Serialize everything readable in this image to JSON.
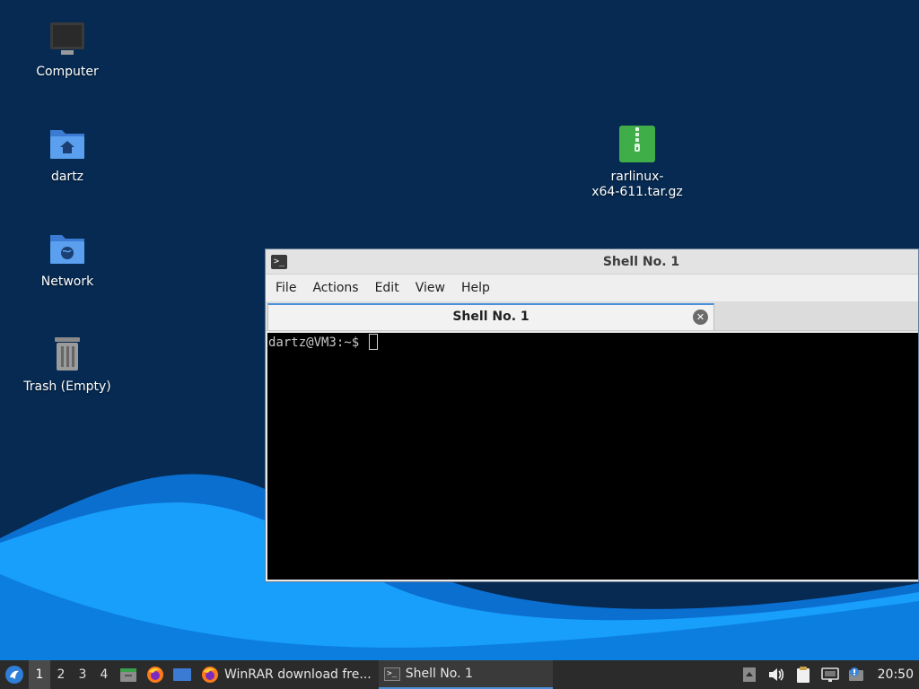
{
  "desktop": {
    "icons": [
      {
        "label": "Computer",
        "icon": "computer-icon"
      },
      {
        "label": "dartz",
        "icon": "home-folder-icon"
      },
      {
        "label": "Network",
        "icon": "network-folder-icon"
      },
      {
        "label": "Trash (Empty)",
        "icon": "trash-icon"
      },
      {
        "label": "rarlinux-",
        "label2": "x64-611.tar.gz",
        "icon": "archive-icon"
      }
    ]
  },
  "window": {
    "title": "Shell No. 1",
    "menu": [
      "File",
      "Actions",
      "Edit",
      "View",
      "Help"
    ],
    "tab_title": "Shell No. 1",
    "prompt": "dartz@VM3:~$ "
  },
  "taskbar": {
    "workspaces": [
      "1",
      "2",
      "3",
      "4"
    ],
    "active_workspace": "1",
    "tasks": [
      {
        "label": "WinRAR download fre...",
        "icon": "firefox-icon"
      },
      {
        "label": "Shell No. 1",
        "icon": "terminal-icon"
      }
    ],
    "clock": "20:50"
  },
  "colors": {
    "desktop_bg": "#062a52",
    "wave_light": "#1aa3ff",
    "wave_mid": "#0b7ee0",
    "accent": "#4a90d9",
    "taskbar_bg": "#2b2b2b"
  }
}
